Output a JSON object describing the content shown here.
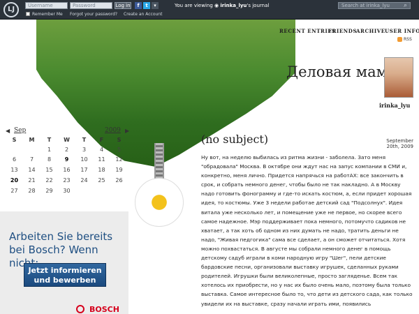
{
  "topbar": {
    "logo": "LJ",
    "username_placeholder": "Username",
    "password_placeholder": "Password",
    "login_label": "Log in",
    "remember_label": "Remember Me",
    "forgot_label": "Forgot your password?",
    "create_label": "Create an Account",
    "viewing_prefix": "You are viewing",
    "viewing_user": "irinka_lyu",
    "viewing_suffix": "'s journal",
    "search_placeholder": "Search at irinka_lyu",
    "search_icon": "search-icon",
    "facebook_icon": "facebook-icon",
    "twitter_icon": "twitter-icon",
    "more_icon": "chevron-down-icon"
  },
  "nav": {
    "items": [
      "RECENT ENTRIES",
      "FRIENDS",
      "ARCHIVE",
      "USER INFO"
    ],
    "rss": "RSS"
  },
  "journal": {
    "title": "Деловая мама",
    "user": "irinka_lyu"
  },
  "calendar": {
    "month": "Sep",
    "year": "2009",
    "day_labels": [
      "S",
      "M",
      "T",
      "W",
      "T",
      "F",
      "S"
    ],
    "weeks": [
      [
        "",
        "",
        "1",
        "2",
        "3",
        "4",
        "5"
      ],
      [
        "6",
        "7",
        "8",
        "9",
        "10",
        "11",
        "12"
      ],
      [
        "13",
        "14",
        "15",
        "16",
        "17",
        "18",
        "19"
      ],
      [
        "20",
        "21",
        "22",
        "23",
        "24",
        "25",
        "26"
      ],
      [
        "27",
        "28",
        "29",
        "30",
        "",
        "",
        ""
      ]
    ]
  },
  "post": {
    "title": "(no subject)",
    "date": "September 20th, 2009",
    "body": "Ну вот, на неделю выбилась из ритма жизни - заболела. Зато меня \"обрадовала\" Москва. В октябре они ждут нас на запус компании в СМИ и, конкретно, меня лично. Придется напрячься на работАХ: все закончить в срок, и собрать немного денег, чтобы было не так накладно. А в Москву надо готовить фонограмму и где-то искать костюм, а, если придет хорошая идея, то костюмы. Уже 3 недели работае детский сад \"Подсолнух\". Идея витала уже несколько лет, и помещение уже не первое, но скорее всего самое надежное. Мэр поддерживает пока немного, потомучто садиков не хватает, а так хоть об одном из них думать не надо, тратить деньги не надо, \"Живая педгогика\" сама все сделает, а он сможет отчитаться. Хотя можно похвастаться. В августе мы собрали немного денег в помощь детскому садуб играли в коми народную игру \"Шег\", пели детские бардовские песни, организовали выставку игрушек, сделанных руками родителей. Игрушки были великолепные, просто загляденье. Всем так хотелось их приобрести, но у нас их было очень мало, поэтому была только выставка. Самое интересное было то, что дети из детского сада, как только увидели их на выставке, сразу начали играть ими, появились"
  },
  "ad": {
    "title": "Arbeiten Sie bereits bei Bosch? Wenn nicht:",
    "button": "Jetzt informieren und bewerben",
    "brand": "BOSCH"
  }
}
